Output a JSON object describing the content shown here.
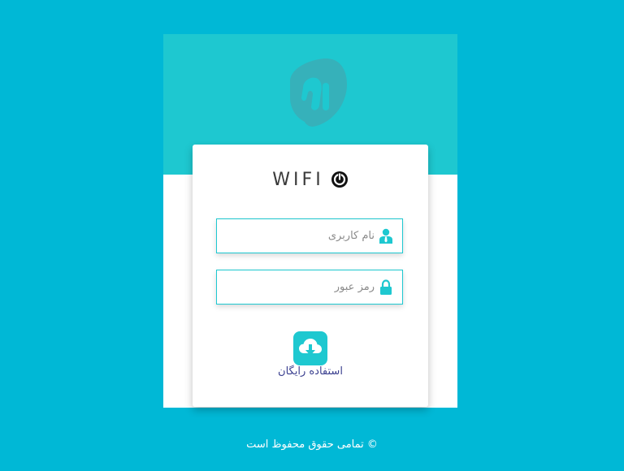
{
  "brand": {
    "logo_icon": "brand-logo-icon",
    "wifi_text": "WIFI",
    "wifi_icon": "power-icon"
  },
  "login": {
    "username": {
      "placeholder": "نام کاربری",
      "value": "",
      "icon": "user-icon"
    },
    "password": {
      "placeholder": "رمز عبور",
      "value": "",
      "icon": "lock-icon"
    },
    "free_use": {
      "icon": "cloud-download-icon",
      "label": "استفاده رایگان"
    }
  },
  "footer": {
    "copyright": "© تمامی حقوق محفوظ است"
  },
  "colors": {
    "background": "#00b8d6",
    "accent": "#1ec8d0",
    "card": "#ffffff",
    "link": "#3a3f8f"
  }
}
